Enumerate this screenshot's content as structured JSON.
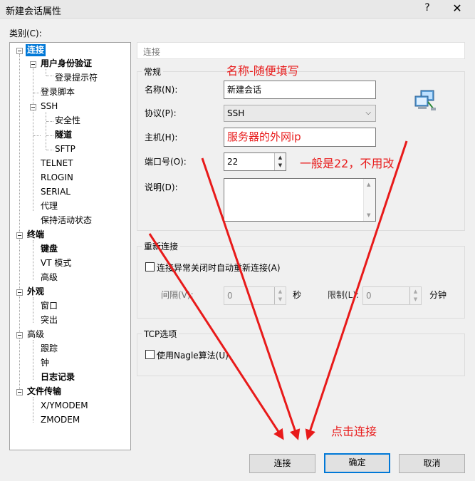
{
  "window": {
    "title": "新建会话属性",
    "help": "?",
    "close": "✕"
  },
  "category_label": "类别(C):",
  "tree": [
    {
      "label": "连接"
    },
    {
      "label": "用户身份验证"
    },
    {
      "label": "登录提示符"
    },
    {
      "label": "登录脚本"
    },
    {
      "label": "SSH"
    },
    {
      "label": "安全性"
    },
    {
      "label": "隧道"
    },
    {
      "label": "SFTP"
    },
    {
      "label": "TELNET"
    },
    {
      "label": "RLOGIN"
    },
    {
      "label": "SERIAL"
    },
    {
      "label": "代理"
    },
    {
      "label": "保持活动状态"
    },
    {
      "label": "终端"
    },
    {
      "label": "键盘"
    },
    {
      "label": "VT 模式"
    },
    {
      "label": "高级"
    },
    {
      "label": "外观"
    },
    {
      "label": "窗口"
    },
    {
      "label": "突出"
    },
    {
      "label": "高级"
    },
    {
      "label": "跟踪"
    },
    {
      "label": "钟"
    },
    {
      "label": "日志记录"
    },
    {
      "label": "文件传输"
    },
    {
      "label": "X/YMODEM"
    },
    {
      "label": "ZMODEM"
    }
  ],
  "header": "连接",
  "general": {
    "title": "常规",
    "name_label": "名称(N):",
    "name_value": "新建会话",
    "protocol_label": "协议(P):",
    "protocol_value": "SSH",
    "host_label": "主机(H):",
    "host_value": "服务器的外网ip",
    "port_label": "端口号(O):",
    "port_value": "22",
    "desc_label": "说明(D):",
    "desc_value": ""
  },
  "reconnect": {
    "title": "重新连接",
    "checkbox_label": "连接异常关闭时自动重新连接(A)",
    "interval_label": "间隔(V):",
    "interval_value": "0",
    "interval_unit": "秒",
    "limit_label": "限制(L):",
    "limit_value": "0",
    "limit_unit": "分钟"
  },
  "tcp": {
    "title": "TCP选项",
    "nagle_label": "使用Nagle算法(U)"
  },
  "buttons": {
    "connect": "连接",
    "ok": "确定",
    "cancel": "取消"
  },
  "annotations": {
    "name_hint": "名称-随便填写",
    "port_hint": "一般是22，不用改",
    "click_hint": "点击连接",
    "color": "#e81a1a"
  },
  "icons": {
    "session": "network-computer-icon"
  }
}
